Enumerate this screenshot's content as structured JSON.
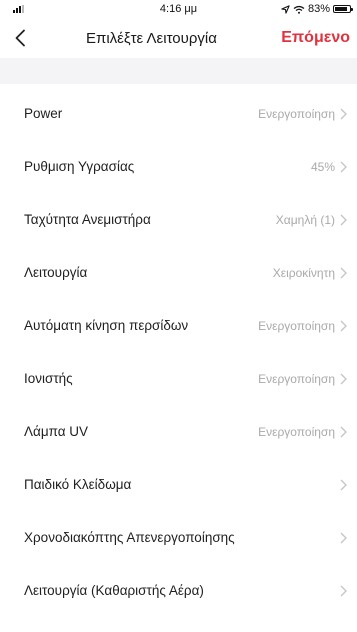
{
  "status_bar": {
    "time": "4:16 μμ",
    "battery": "83%",
    "battery_level": 0.83,
    "signal_icon": "cellular-signal-icon",
    "location_icon": "location-arrow-icon",
    "wifi_icon": "wifi-icon"
  },
  "header": {
    "back_icon": "chevron-left-icon",
    "title": "Επιλέξτε Λειτουργία",
    "next_label": "Επόμενο",
    "accent_color": "#e1323f"
  },
  "functions": [
    {
      "label": "Power",
      "value": "Ενεργοποίηση"
    },
    {
      "label": "Ρυθμιση Υγρασίας",
      "value": "45%"
    },
    {
      "label": "Ταχύτητα Ανεμιστήρα",
      "value": "Χαμηλή (1)"
    },
    {
      "label": "Λειτουργία",
      "value": "Χειροκίνητη"
    },
    {
      "label": "Αυτόματη κίνηση περσίδων",
      "value": "Ενεργοποίηση"
    },
    {
      "label": "Ιονιστής",
      "value": "Ενεργοποίηση"
    },
    {
      "label": "Λάμπα UV",
      "value": "Ενεργοποίηση"
    },
    {
      "label": "Παιδικό Κλείδωμα",
      "value": ""
    },
    {
      "label": "Χρονοδιακόπτης Απενεργοποίησης",
      "value": ""
    },
    {
      "label": "Λειτουργία (Καθαριστής Αέρα)",
      "value": ""
    }
  ],
  "row_icon": "chevron-right-icon"
}
